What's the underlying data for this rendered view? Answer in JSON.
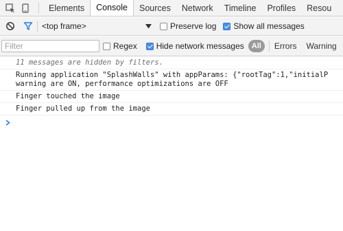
{
  "toolbar": {
    "tabs": [
      "Elements",
      "Console",
      "Sources",
      "Network",
      "Timeline",
      "Profiles",
      "Resou"
    ]
  },
  "context": {
    "frame_label": "<top frame>",
    "preserve_log": "Preserve log",
    "show_all": "Show all messages"
  },
  "filter": {
    "placeholder": "Filter",
    "regex": "Regex",
    "hide_network": "Hide network messages",
    "levels": [
      "All",
      "Errors",
      "Warning"
    ]
  },
  "console": {
    "hidden_notice": "11 messages are hidden by filters.",
    "messages": [
      "Running application \"SplashWalls\" with appParams: {\"rootTag\":1,\"initialP\nwarning are ON, performance optimizations are OFF",
      "Finger touched the image",
      "Finger pulled up from the image"
    ]
  },
  "colors": {
    "accent": "#2d7be5",
    "toolbar_bg": "#f3f3f3",
    "pill_bg": "#9a9a9a"
  },
  "icons": [
    "inspect-icon",
    "device-mode-icon",
    "clear-console-icon",
    "filter-icon",
    "dropdown-arrow-icon",
    "prompt-chevron-icon"
  ]
}
